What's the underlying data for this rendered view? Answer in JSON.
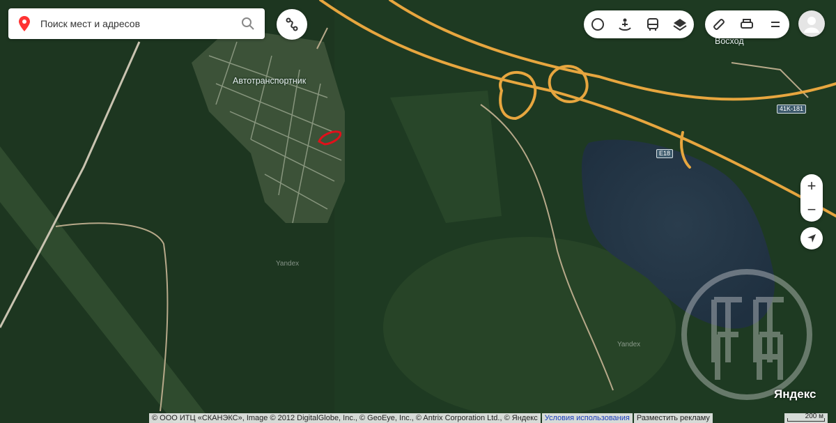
{
  "search": {
    "placeholder": "Поиск мест и адресов"
  },
  "map": {
    "labels": {
      "settlement_main": "Автотранспортник",
      "settlement_ne": "Восход",
      "road_41k": "41K-181",
      "road_e18": "E18",
      "watermark_1": "Yandex",
      "watermark_2": "Yandex"
    }
  },
  "controls": {
    "layers": [
      "traffic-icon",
      "panorama-icon",
      "transit-icon",
      "layers-icon"
    ],
    "tools": [
      "ruler-icon",
      "print-icon",
      "menu-icon"
    ],
    "zoom_in": "+",
    "zoom_out": "−"
  },
  "brand": "Яндекс",
  "footer": {
    "copyright": "© ООО ИТЦ «СКАНЭКС», Image © 2012 DigitalGlobe, Inc., © GeoEye, Inc., © Antrix Corporation Ltd., © Яндекс",
    "terms": "Условия использования",
    "ads": "Разместить рекламу"
  },
  "scale": {
    "label": "200 м"
  },
  "colors": {
    "road": "#e7a63f",
    "forest": "#1f3a22",
    "water": "#26384a",
    "marker": "#e0101a"
  }
}
